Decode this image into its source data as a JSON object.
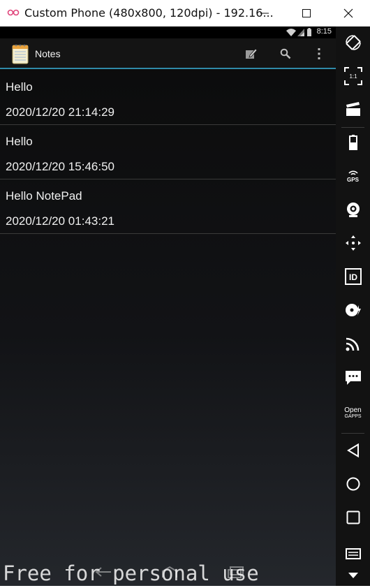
{
  "window": {
    "title": "Custom Phone (480x800, 120dpi) - 192.16..."
  },
  "status_bar": {
    "time": "8:15"
  },
  "action_bar": {
    "title": "Notes",
    "accent_color": "#2f8aa8"
  },
  "notes": [
    {
      "title": "Hello",
      "date": "2020/12/20 21:14:29"
    },
    {
      "title": "Hello",
      "date": "2020/12/20 15:46:50"
    },
    {
      "title": "Hello NotePad",
      "date": "2020/12/20 01:43:21"
    }
  ],
  "watermark": "Free for personal use",
  "sidebar": {
    "tools": [
      {
        "name": "rotate-icon"
      },
      {
        "name": "pixel-perfect-icon",
        "label": "1:1"
      },
      {
        "name": "capture-icon"
      },
      {
        "name": "battery-icon"
      },
      {
        "name": "gps-icon",
        "label": "GPS"
      },
      {
        "name": "camera-icon"
      },
      {
        "name": "dpad-icon"
      },
      {
        "name": "device-id-icon",
        "label": "ID"
      },
      {
        "name": "disk-io-icon"
      },
      {
        "name": "network-icon"
      },
      {
        "name": "sms-icon"
      },
      {
        "name": "open-gapps-icon",
        "label_line1": "Open",
        "label_line2": "GAPPS"
      },
      {
        "name": "back-icon"
      },
      {
        "name": "home-icon"
      },
      {
        "name": "recent-apps-icon"
      },
      {
        "name": "menu-icon"
      }
    ]
  }
}
